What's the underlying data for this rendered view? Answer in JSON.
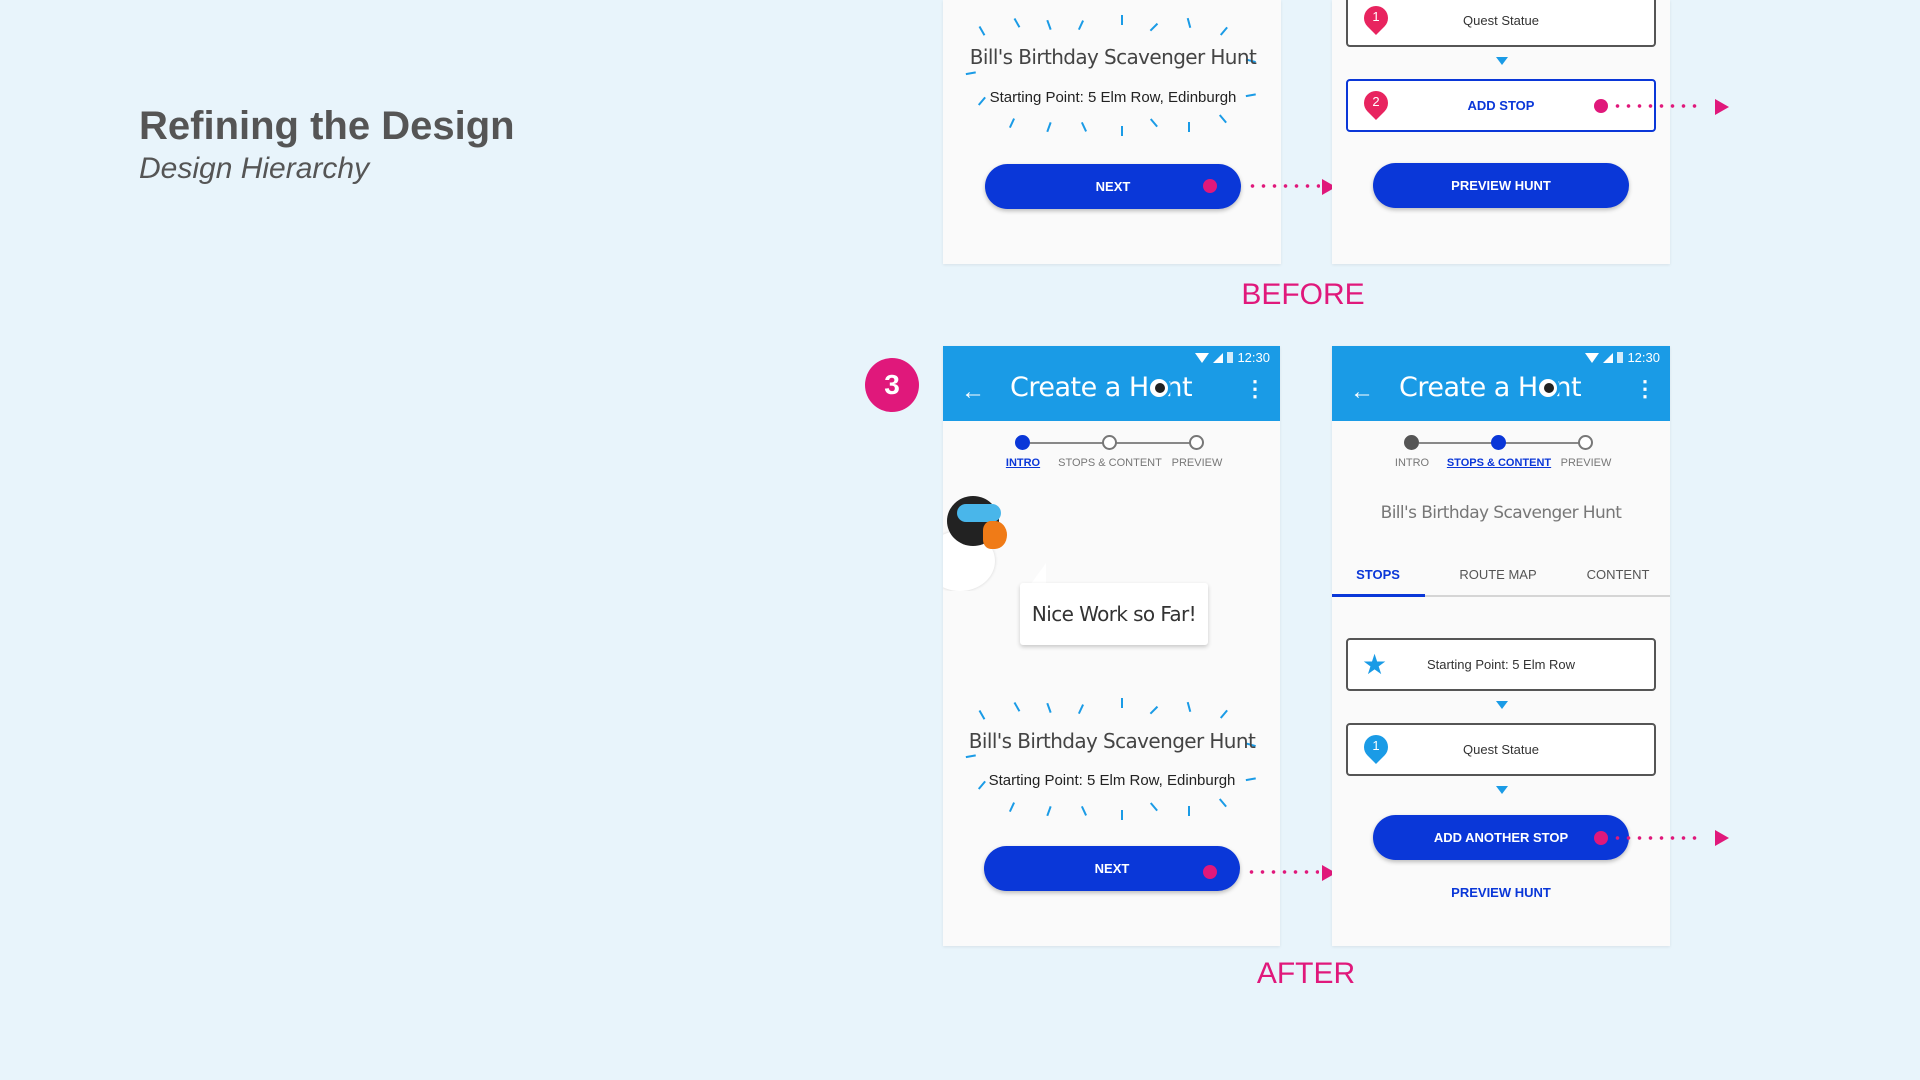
{
  "slide": {
    "title": "Refining the Design",
    "subtitle": "Design Hierarchy",
    "step_badge": "3",
    "before_label": "BEFORE",
    "after_label": "AFTER"
  },
  "colors": {
    "accent": "#0a37d8",
    "appbar": "#1a9be6",
    "annotation": "#e0187b",
    "background": "#e8f4fb"
  },
  "hunt": {
    "name": "Bill's Birthday Scavenger Hunt",
    "start": "Starting Point: 5 Elm Row, Edinburgh"
  },
  "before": {
    "intro": {
      "next_label": "NEXT"
    },
    "stops": {
      "stop1_number": "1",
      "stop1_label": "Quest Statue",
      "stop2_number": "2",
      "add_stop_label": "ADD STOP",
      "preview_label": "PREVIEW HUNT"
    }
  },
  "after": {
    "intro": {
      "app_title": "Create a Hunt",
      "time": "12:30",
      "steps": [
        "INTRO",
        "STOPS & CONTENT",
        "PREVIEW"
      ],
      "bubble": "Nice Work so Far!",
      "next_label": "NEXT"
    },
    "stops": {
      "app_title": "Create a Hunt",
      "time": "12:30",
      "steps": [
        "INTRO",
        "STOPS & CONTENT",
        "PREVIEW"
      ],
      "hunt_name": "Bill's Birthday Scavenger Hunt",
      "tabs": [
        "STOPS",
        "ROUTE MAP",
        "CONTENT"
      ],
      "start_label": "Starting Point: 5 Elm Row",
      "stop1_number": "1",
      "stop1_label": "Quest Statue",
      "add_another_label": "ADD ANOTHER STOP",
      "preview_label": "PREVIEW HUNT"
    }
  }
}
